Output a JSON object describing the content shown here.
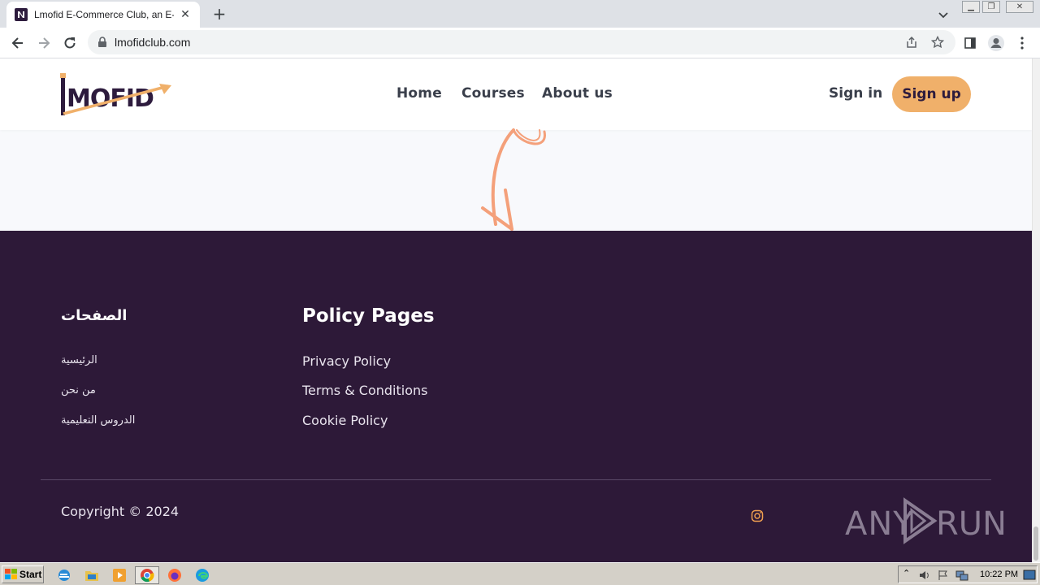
{
  "browser": {
    "tab_title": "Lmofid E-Commerce Club, an E-Comm",
    "url": "lmofidclub.com"
  },
  "header": {
    "logo_text": "LMOFID",
    "nav": [
      {
        "label": "Home"
      },
      {
        "label": "Courses"
      },
      {
        "label": "About us"
      }
    ],
    "signin": "Sign in",
    "signup": "Sign up"
  },
  "footer": {
    "col1": {
      "title": "الصفحات",
      "links": [
        "الرئيسية",
        "من نحن",
        "الدروس التعليمية"
      ]
    },
    "col2": {
      "title": "Policy Pages",
      "links": [
        "Privacy Policy",
        "Terms & Conditions",
        "Cookie Policy"
      ]
    },
    "copyright": "Copyright © 2024",
    "watermark": "ANY RUN"
  },
  "taskbar": {
    "start": "Start",
    "time": "10:22 PM"
  },
  "colors": {
    "footer_bg": "#2d1938",
    "accent": "#f0b06a",
    "nav_text": "#3a3f4b"
  }
}
